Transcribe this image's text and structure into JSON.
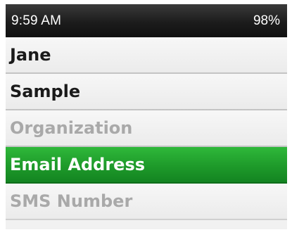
{
  "status_bar": {
    "time": "9:59 AM",
    "battery": "98%"
  },
  "fields": [
    {
      "key": "first-name",
      "text": "Jane",
      "state": "filled"
    },
    {
      "key": "last-name",
      "text": "Sample",
      "state": "filled"
    },
    {
      "key": "organization",
      "text": "Organization",
      "state": "placeholder"
    },
    {
      "key": "email-address",
      "text": "Email Address",
      "state": "selected"
    },
    {
      "key": "sms-number",
      "text": "SMS Number",
      "state": "placeholder"
    }
  ],
  "colors": {
    "selected_highlight": "#1e9a2a",
    "placeholder_text": "#a9a9a9",
    "status_bar_background": "#1c1c1c"
  }
}
